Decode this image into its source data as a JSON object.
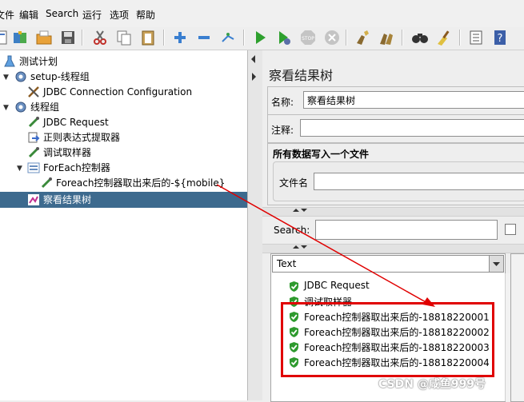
{
  "menu": [
    "文件",
    "编辑",
    "Search",
    "运行",
    "选项",
    "帮助"
  ],
  "toolbar_icons": [
    "template-icon",
    "open-icon",
    "open-folder-icon",
    "save-icon",
    "cut-icon",
    "copy-icon",
    "paste-icon",
    "expand-icon",
    "collapse-icon",
    "toggle-icon",
    "start-icon",
    "start-no-timers-icon",
    "stop-icon",
    "shutdown-icon",
    "clear-icon",
    "clear-all-icon",
    "search-icon",
    "reset-search-icon",
    "function-helper-icon",
    "help-icon"
  ],
  "tree": {
    "nodes": [
      {
        "label": "测试计划",
        "icon": "flask-icon"
      },
      {
        "label": "setup-线程组",
        "icon": "gear-icon"
      },
      {
        "label": "JDBC Connection Configuration",
        "icon": "wrench-icon"
      },
      {
        "label": "线程组",
        "icon": "gear-icon"
      },
      {
        "label": "JDBC Request",
        "icon": "pipette-icon"
      },
      {
        "label": "正则表达式提取器",
        "icon": "extractor-icon"
      },
      {
        "label": "调试取样器",
        "icon": "pipette-icon"
      },
      {
        "label": "ForEach控制器",
        "icon": "controller-icon"
      },
      {
        "label": "Foreach控制器取出来后的-${mobile}",
        "icon": "pipette-icon"
      },
      {
        "label": "察看结果树",
        "icon": "listener-icon"
      }
    ]
  },
  "right": {
    "title": "察看结果树",
    "name_label": "名称:",
    "name_value": "察看结果树",
    "comment_label": "注释:",
    "file_group_title": "所有数据写入一个文件",
    "filename_label": "文件名",
    "search_label": "Search:",
    "renderer": "Text",
    "results": [
      "JDBC Request",
      "调试取样器",
      "Foreach控制器取出来后的-18818220001",
      "Foreach控制器取出来后的-18818220002",
      "Foreach控制器取出来后的-18818220003",
      "Foreach控制器取出来后的-18818220004"
    ]
  },
  "watermark": "CSDN @咸鱼999号",
  "colors": {
    "selection": "#3d6a8e",
    "annotation": "#e00000",
    "success": "#2e9a2e"
  }
}
